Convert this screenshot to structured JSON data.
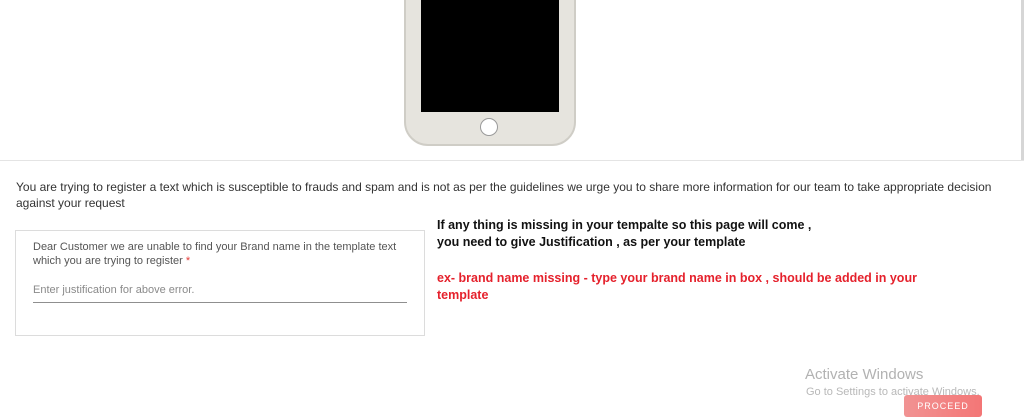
{
  "colors": {
    "accent": "#f37070",
    "note_red": "#e5212c",
    "required_star": "#e53935"
  },
  "warning": {
    "text": "You are trying to register a text which is susceptible to frauds and spam and is not as per the guidelines we urge you to share more information for our team to take appropriate decision against your request"
  },
  "justification_card": {
    "label": "Dear Customer we are unable to find your Brand name in the template text which you are trying to register",
    "required_mark": "*",
    "placeholder": "Enter justification for above error.",
    "value": ""
  },
  "annotation": {
    "line1": "If any thing is missing in your tempalte so this page will come ,",
    "line2": "you need to give Justification , as per your template",
    "example": "ex- brand name missing - type your brand name in box , should be added in your template"
  },
  "watermark": {
    "title": "Activate Windows",
    "subtitle": "Go to Settings to activate Windows."
  },
  "actions": {
    "proceed_label": "PROCEED"
  }
}
